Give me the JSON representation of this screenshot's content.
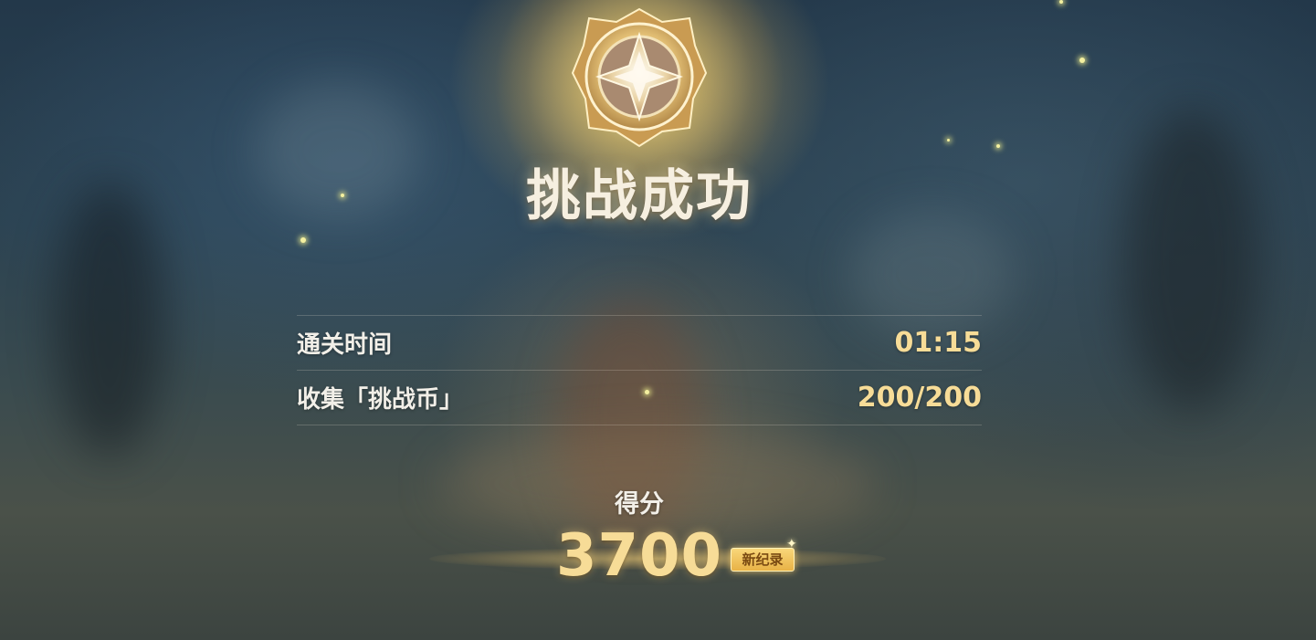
{
  "result": {
    "title": "挑战成功",
    "emblem_icon": "star-compass-medal-icon"
  },
  "stats": [
    {
      "label": "通关时间",
      "value": "01:15"
    },
    {
      "label": "收集「挑战币」",
      "value": "200/200"
    }
  ],
  "score": {
    "label": "得分",
    "value": "3700",
    "badge": "新纪录"
  },
  "colors": {
    "accent_gold": "#f7dc97",
    "text_light": "#f2efe8",
    "badge_gold": "#e8b246"
  }
}
